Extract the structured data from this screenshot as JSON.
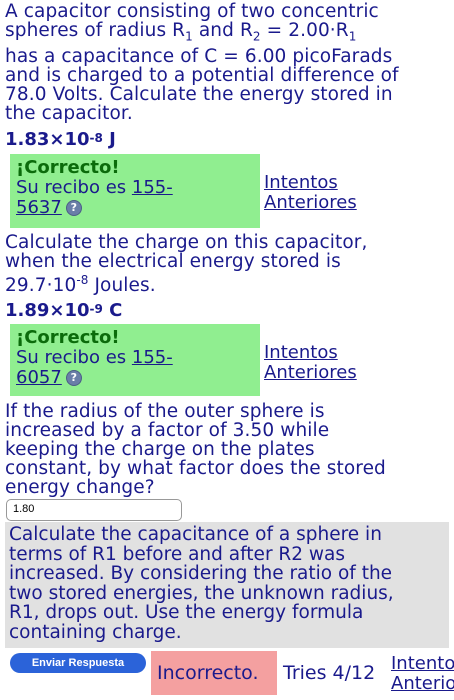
{
  "q1": {
    "l1": "A capacitor consisting of two concentric",
    "l2a": "spheres of radius R",
    "l2s1": "1",
    "l2b": " and R",
    "l2s2": "2",
    "l2c": " = 2.00·R",
    "l2s3": "1",
    "l3": "has a capacitance of C = 6.00 picoFarads",
    "l4": "and is charged to a potential difference of",
    "l5": "78.0 Volts. Calculate the energy stored in",
    "l6": "the capacitor.",
    "answer_base": "1.83×10",
    "answer_exp": "-8",
    "answer_unit": " J",
    "feedback": "¡Correcto!",
    "receipt_label": "Su recibo es ",
    "receipt_a": "155-",
    "receipt_b": "5637",
    "prev_a": "Intentos",
    "prev_b": "Anteriores"
  },
  "q2": {
    "l1": "Calculate the charge on this capacitor,",
    "l2": "when the electrical energy stored is",
    "l3a": "29.7·10",
    "l3exp": "-8",
    "l3b": " Joules.",
    "answer_base": "1.89×10",
    "answer_exp": "-9",
    "answer_unit": " C",
    "feedback": "¡Correcto!",
    "receipt_label": "Su recibo es ",
    "receipt_a": "155-",
    "receipt_b": "6057",
    "prev_a": "Intentos",
    "prev_b": "Anteriores"
  },
  "q3": {
    "l1": "If the radius of the outer sphere is",
    "l2": "increased by a factor of 3.50 while",
    "l3": "keeping the charge on the plates",
    "l4": "constant, by what factor does the stored",
    "l5": "energy change?",
    "input_value": "1.80",
    "hint": [
      "Calculate the capacitance of a sphere in",
      "terms of R1 before and after R2 was",
      "increased. By considering the ratio of the",
      "two stored energies, the unknown radius,",
      "R1, drops out. Use the energy formula",
      "containing charge."
    ],
    "submit_label": "Enviar Respuesta",
    "result": "Incorrecto.",
    "tries": "Tries 4/12",
    "prev_a": "Intentos",
    "prev_b": "Anteriores"
  },
  "colors": {
    "text": "#1a1a8c",
    "correct_bg": "#90ee90",
    "incorrect_bg": "#f4a0a0",
    "hint_bg": "#e1e1e1",
    "button": "#2b63d9"
  },
  "icons": [
    "help-icon"
  ]
}
